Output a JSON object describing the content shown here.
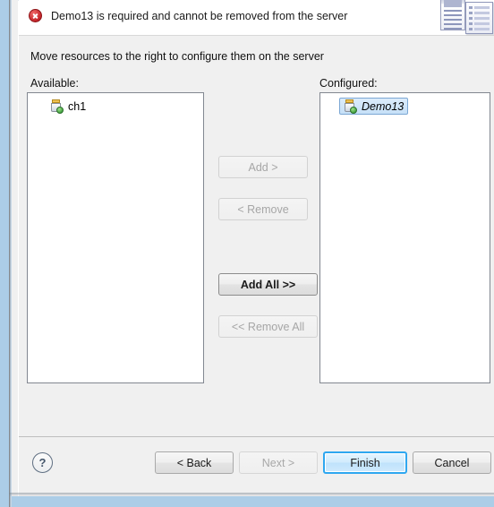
{
  "dialog": {
    "message": "Demo13 is required and cannot be removed from the server",
    "message_icon": "error-icon",
    "header_icon_back": "document-stack-icon",
    "header_icon_front": "document-list-icon",
    "instruction": "Move resources to the right to configure them on the server"
  },
  "available": {
    "label": "Available:",
    "items": [
      {
        "name": "ch1",
        "icon": "module-jar-icon",
        "selected": false
      }
    ]
  },
  "configured": {
    "label": "Configured:",
    "items": [
      {
        "name": "Demo13",
        "icon": "module-jar-icon",
        "selected": true
      }
    ]
  },
  "transfer_buttons": [
    {
      "label": "Add >",
      "enabled": false,
      "name": "add-button"
    },
    {
      "label": "< Remove",
      "enabled": false,
      "name": "remove-button"
    },
    {
      "label": "Add All >>",
      "enabled": true,
      "name": "add-all-button"
    },
    {
      "label": "<< Remove All",
      "enabled": false,
      "name": "remove-all-button"
    }
  ],
  "footer": {
    "help_label": "?",
    "back_label": "< Back",
    "next_label": "Next >",
    "finish_label": "Finish",
    "cancel_label": "Cancel"
  },
  "colors": {
    "error_red": "#c4252a",
    "default_button_blue": "#2ea7f0",
    "selection_blue": "#c6e0f7",
    "window_border": "#a8cae6"
  }
}
